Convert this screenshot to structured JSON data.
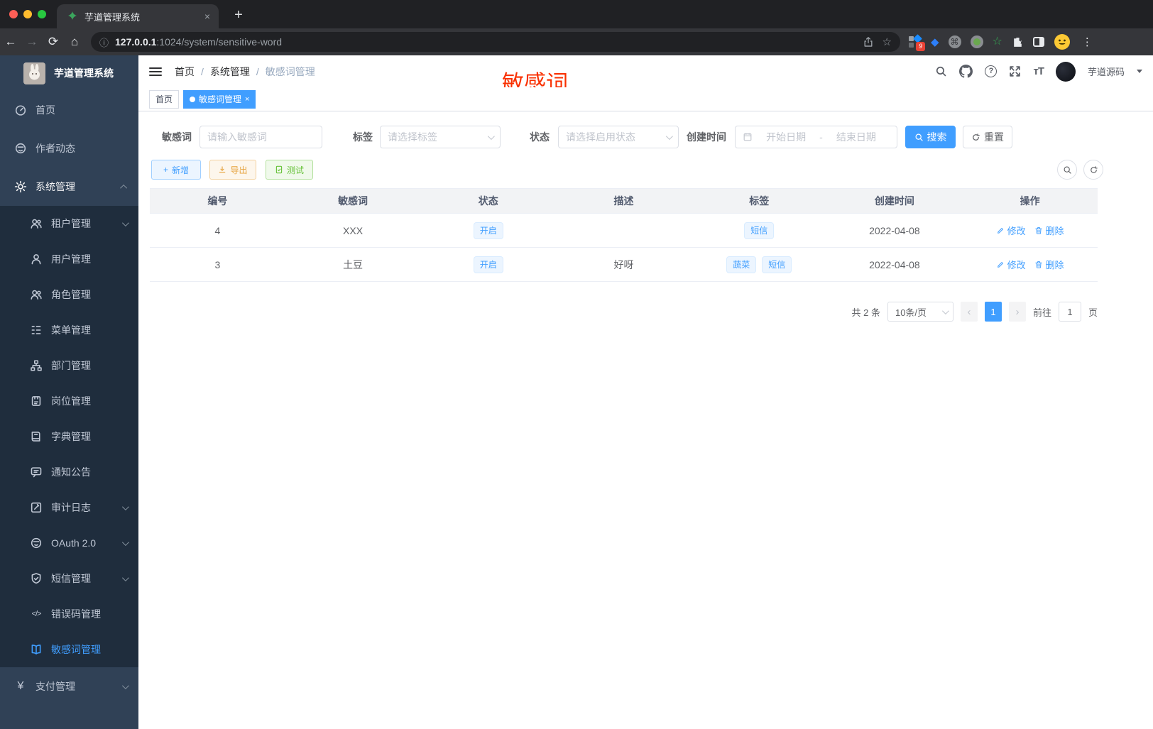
{
  "browser": {
    "tab_title": "芋道管理系统",
    "url_host": "127.0.0.1",
    "url_path": ":1024/system/sensitive-word",
    "extension_badge": "9"
  },
  "icons": {
    "close": "×",
    "plus": "+",
    "newtab": "+",
    "dots": "⋮",
    "star": "☆",
    "help": "?",
    "yen": "¥",
    "code": "</>",
    "prev": "‹",
    "next": "›",
    "cmd": "⌘",
    "back": "←",
    "fwd": "→",
    "reload": "⟳",
    "home": "⌂",
    "info": "ⓘ",
    "tt": "тT"
  },
  "sidebar": {
    "logo_title": "芋道管理系统",
    "items": [
      {
        "label": "首页"
      },
      {
        "label": "作者动态"
      },
      {
        "label": "系统管理"
      },
      {
        "label": "租户管理"
      },
      {
        "label": "用户管理"
      },
      {
        "label": "角色管理"
      },
      {
        "label": "菜单管理"
      },
      {
        "label": "部门管理"
      },
      {
        "label": "岗位管理"
      },
      {
        "label": "字典管理"
      },
      {
        "label": "通知公告"
      },
      {
        "label": "审计日志"
      },
      {
        "label": "OAuth 2.0"
      },
      {
        "label": "短信管理"
      },
      {
        "label": "错误码管理"
      },
      {
        "label": "敏感词管理"
      },
      {
        "label": "支付管理"
      }
    ]
  },
  "navbar": {
    "breadcrumb": [
      "首页",
      "系统管理",
      "敏感词管理"
    ],
    "separator": "/",
    "username": "芋道源码"
  },
  "annotation": "敏感词",
  "tags_view": {
    "tab_home": "首页",
    "tab_active": "敏感词管理"
  },
  "filters": {
    "keyword_label": "敏感词",
    "keyword_placeholder": "请输入敏感词",
    "tag_label": "标签",
    "tag_placeholder": "请选择标签",
    "status_label": "状态",
    "status_placeholder": "请选择启用状态",
    "date_label": "创建时间",
    "date_start_placeholder": "开始日期",
    "date_sep": "-",
    "date_end_placeholder": "结束日期",
    "search_label": "搜索",
    "reset_label": "重置"
  },
  "toolbar": {
    "add_label": "新增",
    "export_label": "导出",
    "test_label": "测试"
  },
  "table": {
    "columns": [
      "编号",
      "敏感词",
      "状态",
      "描述",
      "标签",
      "创建时间",
      "操作"
    ],
    "edit_label": "修改",
    "delete_label": "删除",
    "rows": [
      {
        "id": "4",
        "word": "XXX",
        "status": "开启",
        "description": "",
        "tags": [
          "短信"
        ],
        "created": "2022-04-08"
      },
      {
        "id": "3",
        "word": "土豆",
        "status": "开启",
        "description": "好呀",
        "tags": [
          "蔬菜",
          "短信"
        ],
        "created": "2022-04-08"
      }
    ]
  },
  "pagination": {
    "total_text": "共 2 条",
    "page_size": "10条/页",
    "current_page": "1",
    "goto_label": "前往",
    "goto_value": "1",
    "unit_label": "页"
  },
  "colors": {
    "primary": "#409eff",
    "sidebar_bg": "#304156",
    "submenu_bg": "#1f2d3d",
    "annotation_red": "#f93000",
    "warning": "#e6a23c",
    "success": "#67c23a"
  }
}
